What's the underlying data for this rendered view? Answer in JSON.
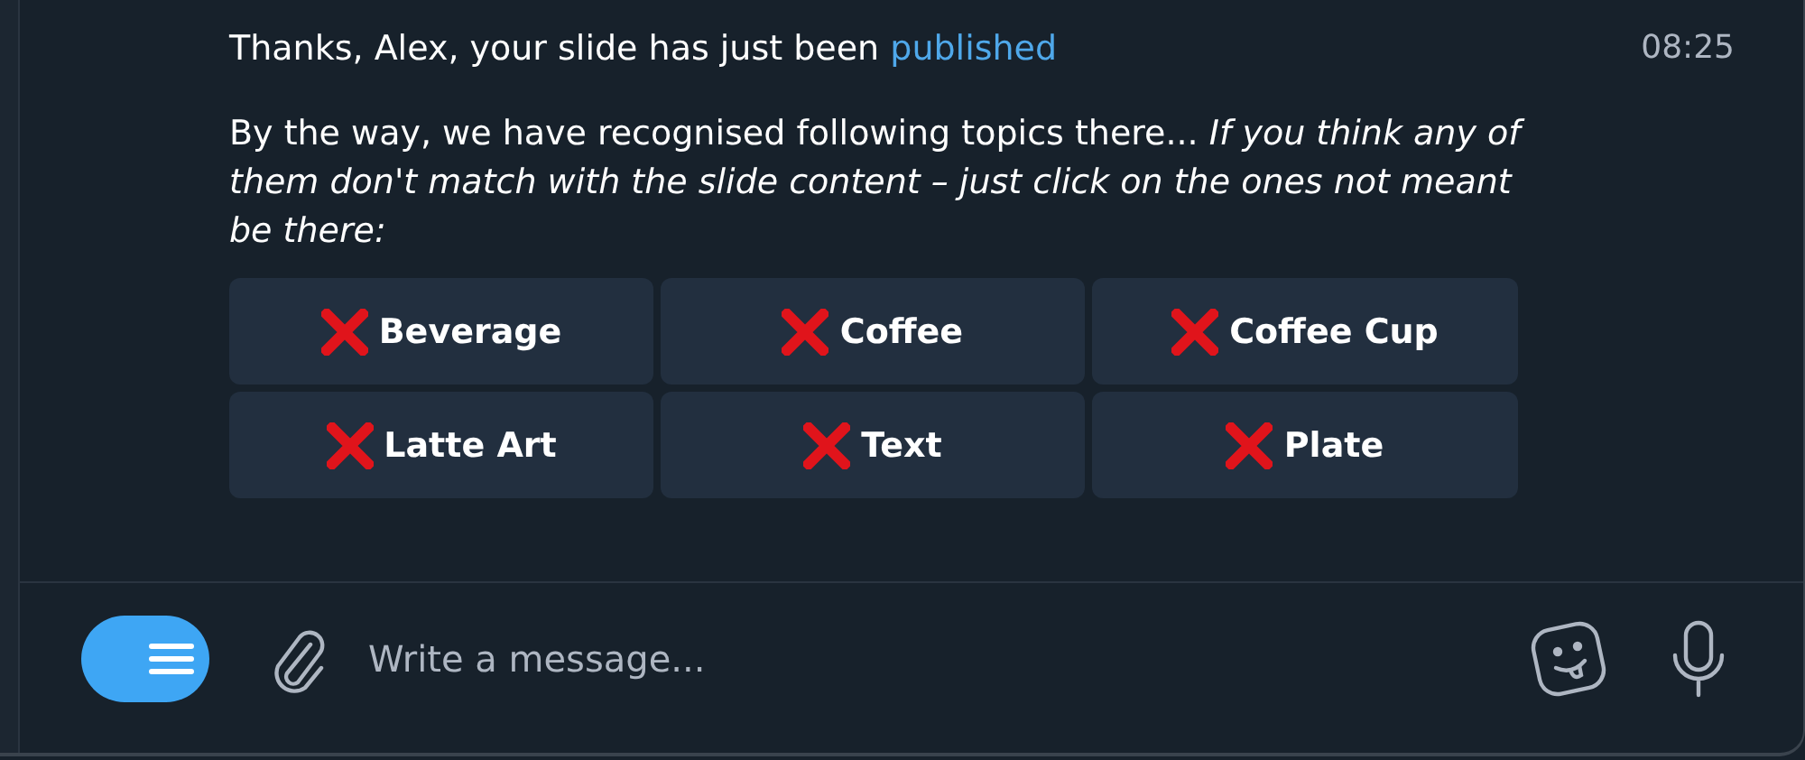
{
  "message": {
    "greeting": "Thanks, Alex, your slide has just been",
    "link": "published",
    "time": "08:25",
    "body": "By the way, we have recognised following topics there... *If you think any of them don't match with the slide content – just click on the ones not meant be there:*"
  },
  "topics": [
    {
      "label": "Beverage"
    },
    {
      "label": "Coffee"
    },
    {
      "label": "Coffee Cup"
    },
    {
      "label": "Latte Art"
    },
    {
      "label": "Text"
    },
    {
      "label": "Plate"
    }
  ],
  "composer": {
    "placeholder": "Write a message..."
  }
}
